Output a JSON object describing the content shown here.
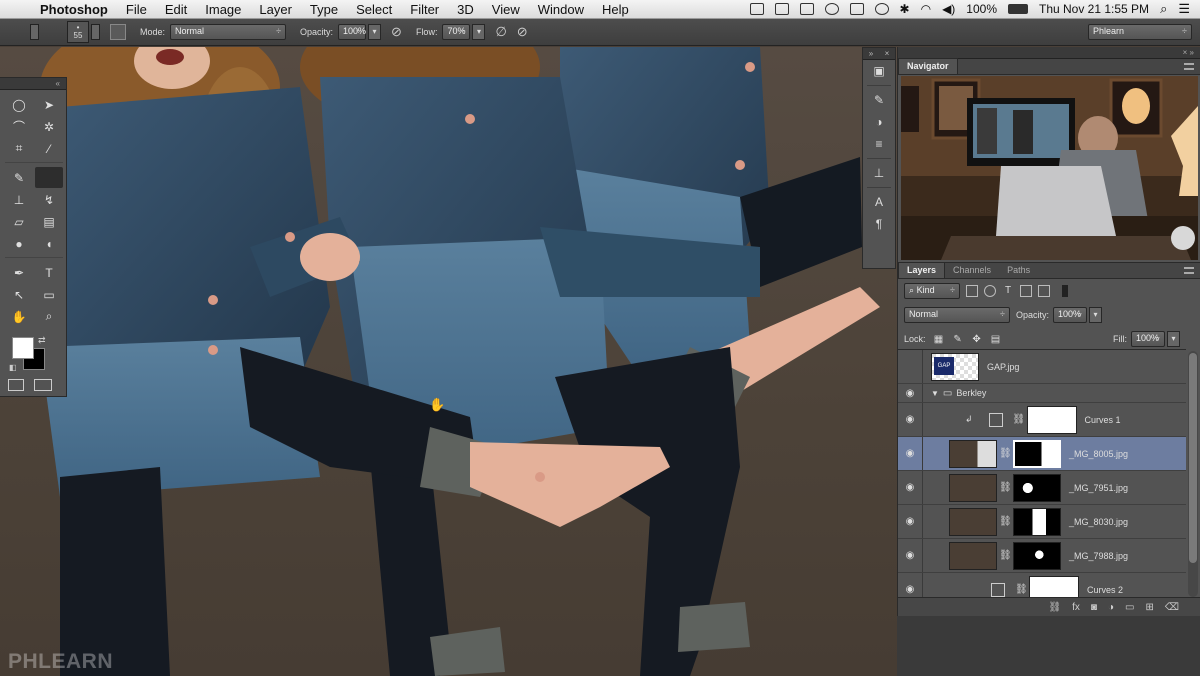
{
  "menubar": {
    "app_name": "Photoshop",
    "menus": [
      "File",
      "Edit",
      "Image",
      "Layer",
      "Type",
      "Select",
      "Filter",
      "3D",
      "View",
      "Window",
      "Help"
    ],
    "battery": "100%",
    "clock": "Thu Nov 21  1:55 PM"
  },
  "options": {
    "brush_size": "55",
    "mode_label": "Mode:",
    "mode_value": "Normal",
    "opacity_label": "Opacity:",
    "opacity_value": "100%",
    "flow_label": "Flow:",
    "flow_value": "70%",
    "workspace": "Phlearn"
  },
  "navigator": {
    "tab": "Navigator"
  },
  "layers_panel": {
    "tabs": [
      "Layers",
      "Channels",
      "Paths"
    ],
    "kind": "Kind",
    "blend_mode": "Normal",
    "opacity_label": "Opacity:",
    "opacity_value": "100%",
    "lock_label": "Lock:",
    "fill_label": "Fill:",
    "fill_value": "100%",
    "layers": [
      {
        "name": "GAP.jpg",
        "thumb_text": "GAP",
        "visible": false
      },
      {
        "name": "Berkley",
        "type": "group",
        "visible": true
      },
      {
        "name": "Curves 1",
        "type": "adjustment",
        "visible": true
      },
      {
        "name": "_MG_8005.jpg",
        "visible": true,
        "selected": true
      },
      {
        "name": "_MG_7951.jpg",
        "visible": true
      },
      {
        "name": "_MG_8030.jpg",
        "visible": true
      },
      {
        "name": "_MG_7988.jpg",
        "visible": true
      },
      {
        "name": "Curves 2",
        "type": "adjustment",
        "visible": true
      }
    ]
  },
  "watermark": "PHLEARN",
  "colors": {
    "panel": "#535353",
    "panel_dark": "#3a3a3a",
    "selected_layer": "#6d7da0",
    "canvas_bg": "#4a4038"
  }
}
